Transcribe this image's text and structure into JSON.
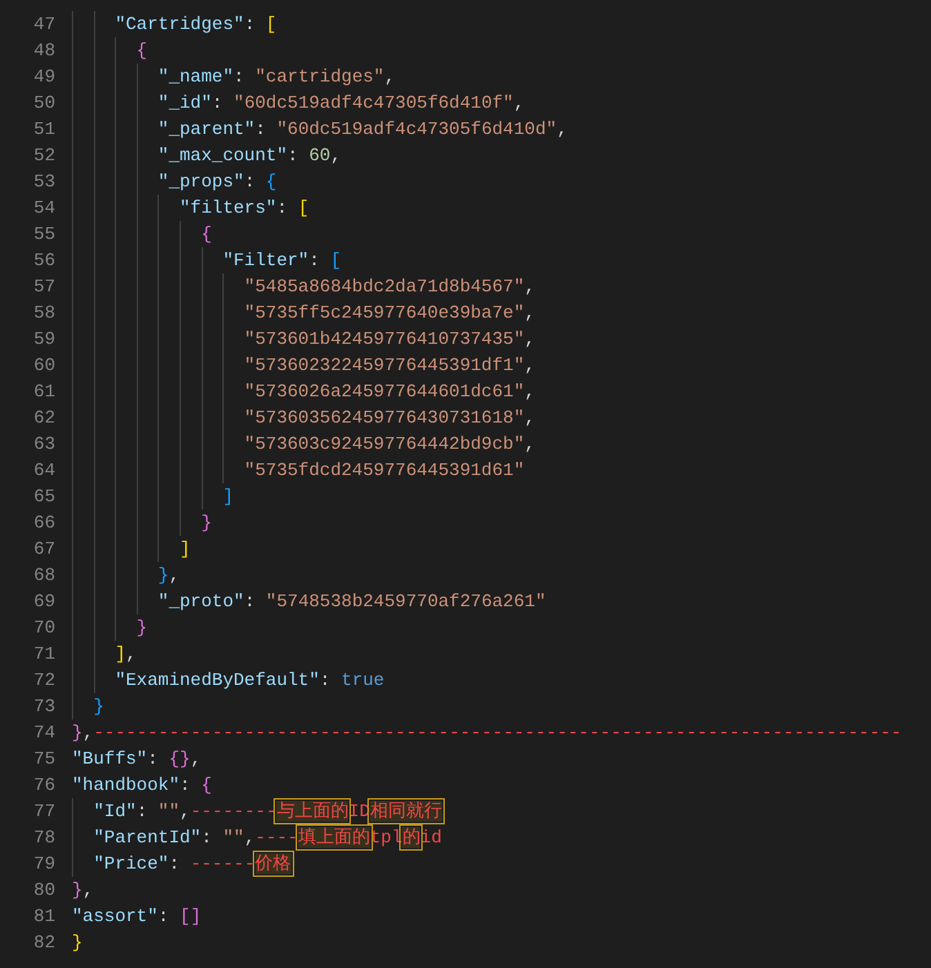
{
  "editor": {
    "lines": [
      {
        "children": [
          {
            "children": [
              {
                "children": [
                  {
                    "number": "47",
                    "tokens": [
                      {
                        "kind": "key",
                        "text": "\"Cartridges\""
                      },
                      {
                        "kind": "punct",
                        "text": ": "
                      },
                      {
                        "kind": "bracket",
                        "text": "[",
                        "color": "#ffd700"
                      }
                    ],
                    "children": [
                      {
                        "number": "48",
                        "tokens": [
                          {
                            "kind": "bracket",
                            "text": "{",
                            "color": "#da70d6"
                          }
                        ],
                        "children": [
                          {
                            "number": "49",
                            "tokens": [
                              {
                                "kind": "key",
                                "text": "\"_name\""
                              },
                              {
                                "kind": "punct",
                                "text": ": "
                              },
                              {
                                "kind": "string",
                                "text": "\"cartridges\""
                              },
                              {
                                "kind": "punct",
                                "text": ","
                              }
                            ]
                          },
                          {
                            "number": "50",
                            "tokens": [
                              {
                                "kind": "key",
                                "text": "\"_id\""
                              },
                              {
                                "kind": "punct",
                                "text": ": "
                              },
                              {
                                "kind": "string",
                                "text": "\"60dc519adf4c47305f6d410f\""
                              },
                              {
                                "kind": "punct",
                                "text": ","
                              }
                            ]
                          },
                          {
                            "number": "51",
                            "tokens": [
                              {
                                "kind": "key",
                                "text": "\"_parent\""
                              },
                              {
                                "kind": "punct",
                                "text": ": "
                              },
                              {
                                "kind": "string",
                                "text": "\"60dc519adf4c47305f6d410d\""
                              },
                              {
                                "kind": "punct",
                                "text": ","
                              }
                            ]
                          },
                          {
                            "number": "52",
                            "tokens": [
                              {
                                "kind": "key",
                                "text": "\"_max_count\""
                              },
                              {
                                "kind": "punct",
                                "text": ": "
                              },
                              {
                                "kind": "number",
                                "text": "60"
                              },
                              {
                                "kind": "punct",
                                "text": ","
                              }
                            ]
                          },
                          {
                            "number": "53",
                            "tokens": [
                              {
                                "kind": "key",
                                "text": "\"_props\""
                              },
                              {
                                "kind": "punct",
                                "text": ": "
                              },
                              {
                                "kind": "bracket",
                                "text": "{",
                                "color": "#179fff"
                              }
                            ],
                            "children": [
                              {
                                "number": "54",
                                "tokens": [
                                  {
                                    "kind": "key",
                                    "text": "\"filters\""
                                  },
                                  {
                                    "kind": "punct",
                                    "text": ": "
                                  },
                                  {
                                    "kind": "bracket",
                                    "text": "[",
                                    "color": "#ffd700"
                                  }
                                ],
                                "children": [
                                  {
                                    "number": "55",
                                    "tokens": [
                                      {
                                        "kind": "bracket",
                                        "text": "{",
                                        "color": "#da70d6"
                                      }
                                    ],
                                    "children": [
                                      {
                                        "number": "56",
                                        "tokens": [
                                          {
                                            "kind": "key",
                                            "text": "\"Filter\""
                                          },
                                          {
                                            "kind": "punct",
                                            "text": ": "
                                          },
                                          {
                                            "kind": "bracket",
                                            "text": "[",
                                            "color": "#179fff"
                                          }
                                        ],
                                        "children": [
                                          {
                                            "number": "57",
                                            "tokens": [
                                              {
                                                "kind": "string",
                                                "text": "\"5485a8684bdc2da71d8b4567\""
                                              },
                                              {
                                                "kind": "punct",
                                                "text": ","
                                              }
                                            ]
                                          },
                                          {
                                            "number": "58",
                                            "tokens": [
                                              {
                                                "kind": "string",
                                                "text": "\"5735ff5c245977640e39ba7e\""
                                              },
                                              {
                                                "kind": "punct",
                                                "text": ","
                                              }
                                            ]
                                          },
                                          {
                                            "number": "59",
                                            "tokens": [
                                              {
                                                "kind": "string",
                                                "text": "\"573601b42459776410737435\""
                                              },
                                              {
                                                "kind": "punct",
                                                "text": ","
                                              }
                                            ]
                                          },
                                          {
                                            "number": "60",
                                            "tokens": [
                                              {
                                                "kind": "string",
                                                "text": "\"573602322459776445391df1\""
                                              },
                                              {
                                                "kind": "punct",
                                                "text": ","
                                              }
                                            ]
                                          },
                                          {
                                            "number": "61",
                                            "tokens": [
                                              {
                                                "kind": "string",
                                                "text": "\"5736026a245977644601dc61\""
                                              },
                                              {
                                                "kind": "punct",
                                                "text": ","
                                              }
                                            ]
                                          },
                                          {
                                            "number": "62",
                                            "tokens": [
                                              {
                                                "kind": "string",
                                                "text": "\"573603562459776430731618\""
                                              },
                                              {
                                                "kind": "punct",
                                                "text": ","
                                              }
                                            ]
                                          },
                                          {
                                            "number": "63",
                                            "tokens": [
                                              {
                                                "kind": "string",
                                                "text": "\"573603c924597764442bd9cb\""
                                              },
                                              {
                                                "kind": "punct",
                                                "text": ","
                                              }
                                            ]
                                          },
                                          {
                                            "number": "64",
                                            "tokens": [
                                              {
                                                "kind": "string",
                                                "text": "\"5735fdcd2459776445391d61\""
                                              }
                                            ]
                                          }
                                        ]
                                      },
                                      {
                                        "number": "65",
                                        "tokens": [
                                          {
                                            "kind": "bracket",
                                            "text": "]",
                                            "color": "#179fff"
                                          }
                                        ]
                                      }
                                    ]
                                  },
                                  {
                                    "number": "66",
                                    "tokens": [
                                      {
                                        "kind": "bracket",
                                        "text": "}",
                                        "color": "#da70d6"
                                      }
                                    ]
                                  }
                                ]
                              },
                              {
                                "number": "67",
                                "tokens": [
                                  {
                                    "kind": "bracket",
                                    "text": "]",
                                    "color": "#ffd700"
                                  }
                                ]
                              }
                            ]
                          },
                          {
                            "number": "68",
                            "tokens": [
                              {
                                "kind": "bracket",
                                "text": "}",
                                "color": "#179fff"
                              },
                              {
                                "kind": "punct",
                                "text": ","
                              }
                            ]
                          },
                          {
                            "number": "69",
                            "tokens": [
                              {
                                "kind": "key",
                                "text": "\"_proto\""
                              },
                              {
                                "kind": "punct",
                                "text": ": "
                              },
                              {
                                "kind": "string",
                                "text": "\"5748538b2459770af276a261\""
                              }
                            ]
                          }
                        ]
                      },
                      {
                        "number": "70",
                        "tokens": [
                          {
                            "kind": "bracket",
                            "text": "}",
                            "color": "#da70d6"
                          }
                        ]
                      }
                    ]
                  },
                  {
                    "number": "71",
                    "tokens": [
                      {
                        "kind": "bracket",
                        "text": "]",
                        "color": "#ffd700"
                      },
                      {
                        "kind": "punct",
                        "text": ","
                      }
                    ]
                  },
                  {
                    "number": "72",
                    "tokens": [
                      {
                        "kind": "key",
                        "text": "\"ExaminedByDefault\""
                      },
                      {
                        "kind": "punct",
                        "text": ": "
                      },
                      {
                        "kind": "boolean",
                        "text": "true"
                      }
                    ]
                  }
                ]
              },
              {
                "number": "73",
                "tokens": [
                  {
                    "kind": "bracket",
                    "text": "}",
                    "color": "#179fff"
                  }
                ]
              }
            ]
          },
          {
            "number": "74",
            "tokens": [
              {
                "kind": "bracket",
                "text": "}",
                "color": "#da70d6"
              },
              {
                "kind": "punct",
                "text": ","
              },
              {
                "kind": "red",
                "text": "---------------------------------------------------------------------------"
              }
            ]
          },
          {
            "number": "75",
            "tokens": [
              {
                "kind": "key",
                "text": "\"Buffs\""
              },
              {
                "kind": "punct",
                "text": ": "
              },
              {
                "kind": "bracket",
                "text": "{}",
                "color": "#da70d6"
              },
              {
                "kind": "punct",
                "text": ","
              }
            ]
          },
          {
            "number": "76",
            "tokens": [
              {
                "kind": "key",
                "text": "\"handbook\""
              },
              {
                "kind": "punct",
                "text": ": "
              },
              {
                "kind": "bracket",
                "text": "{",
                "color": "#da70d6"
              }
            ],
            "children": [
              {
                "number": "77",
                "tokens": [
                  {
                    "kind": "key",
                    "text": "\"Id\""
                  },
                  {
                    "kind": "punct",
                    "text": ": "
                  },
                  {
                    "kind": "string",
                    "text": "\"\""
                  },
                  {
                    "kind": "punct",
                    "text": ","
                  },
                  {
                    "kind": "red",
                    "text": "--------"
                  },
                  {
                    "kind": "boxed",
                    "text": "与上面的"
                  },
                  {
                    "kind": "red",
                    "text": "ID"
                  },
                  {
                    "kind": "boxed",
                    "text": "相同就行"
                  }
                ]
              },
              {
                "number": "78",
                "tokens": [
                  {
                    "kind": "key",
                    "text": "\"ParentId\""
                  },
                  {
                    "kind": "punct",
                    "text": ": "
                  },
                  {
                    "kind": "string",
                    "text": "\"\""
                  },
                  {
                    "kind": "punct",
                    "text": ","
                  },
                  {
                    "kind": "red",
                    "text": "----"
                  },
                  {
                    "kind": "boxed",
                    "text": "填上面的"
                  },
                  {
                    "kind": "red",
                    "text": "tpl"
                  },
                  {
                    "kind": "boxed",
                    "text": "的"
                  },
                  {
                    "kind": "red",
                    "text": "id"
                  }
                ]
              },
              {
                "number": "79",
                "tokens": [
                  {
                    "kind": "key",
                    "text": "\"Price\""
                  },
                  {
                    "kind": "punct",
                    "text": ": "
                  },
                  {
                    "kind": "red",
                    "text": "------"
                  },
                  {
                    "kind": "boxed",
                    "text": "价格"
                  }
                ]
              }
            ]
          },
          {
            "number": "80",
            "tokens": [
              {
                "kind": "bracket",
                "text": "}",
                "color": "#da70d6"
              },
              {
                "kind": "punct",
                "text": ","
              }
            ]
          },
          {
            "number": "81",
            "tokens": [
              {
                "kind": "key",
                "text": "\"assort\""
              },
              {
                "kind": "punct",
                "text": ": "
              },
              {
                "kind": "bracket",
                "text": "[]",
                "color": "#da70d6"
              }
            ]
          }
        ]
      },
      {
        "number": "82",
        "tokens": [
          {
            "kind": "bracket",
            "text": "}",
            "color": "#ffd700"
          }
        ]
      }
    ]
  }
}
